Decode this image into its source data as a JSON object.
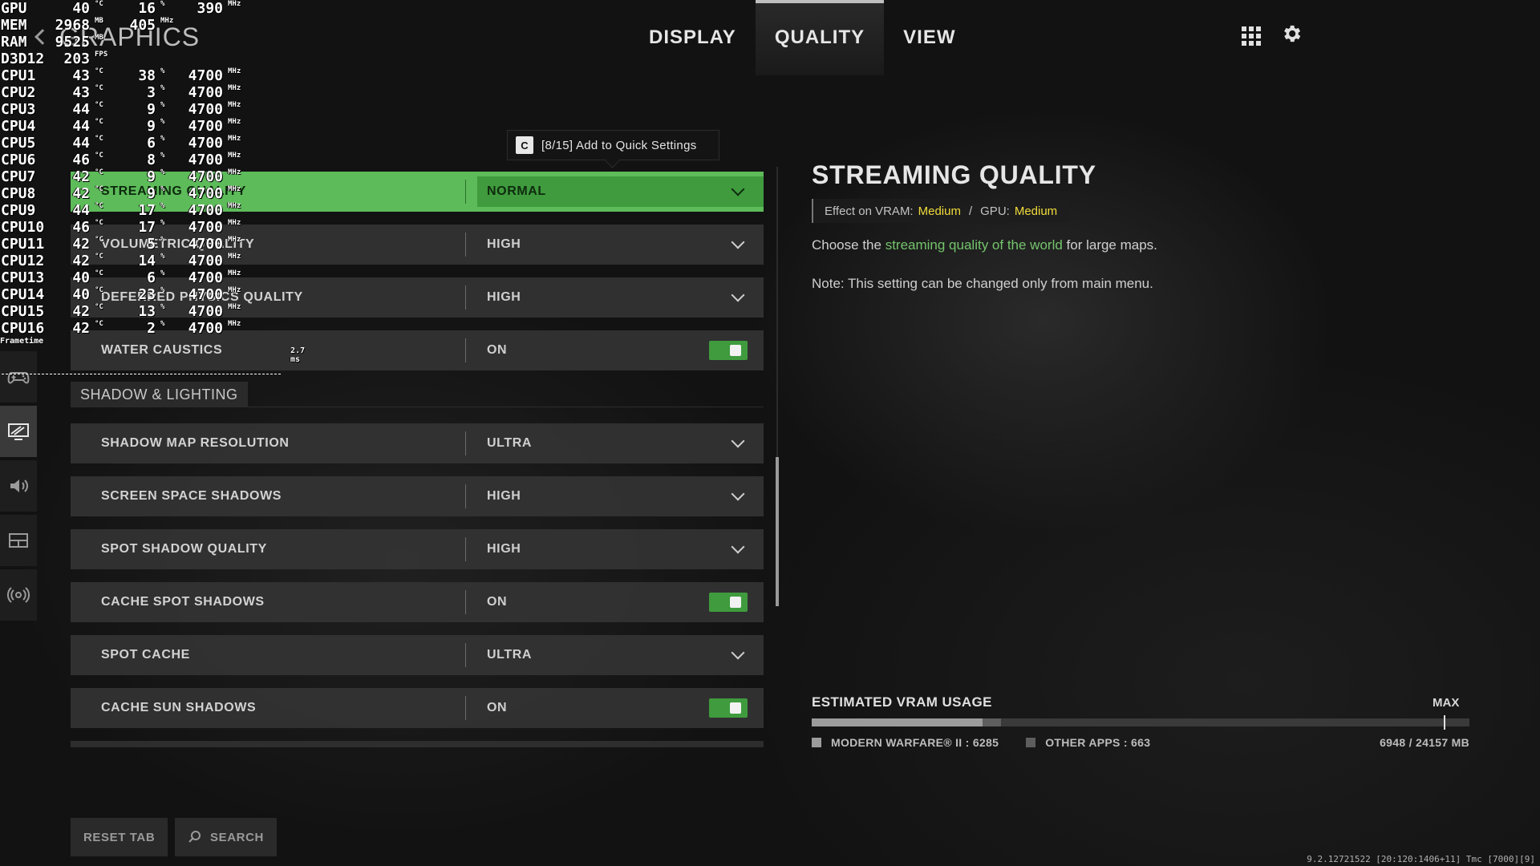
{
  "header": {
    "title": "GRAPHICS",
    "tabs": [
      {
        "label": "DISPLAY",
        "active": false
      },
      {
        "label": "QUALITY",
        "active": true
      },
      {
        "label": "VIEW",
        "active": false
      }
    ]
  },
  "left_nav": {
    "items": [
      {
        "icon": "controller-icon",
        "active": false
      },
      {
        "icon": "graphics-monitor-icon",
        "active": true
      },
      {
        "icon": "speaker-icon",
        "active": false
      },
      {
        "icon": "interface-icon",
        "active": false
      },
      {
        "icon": "network-icon",
        "active": false
      }
    ]
  },
  "tooltip": {
    "key": "C",
    "text": "[8/15] Add to Quick Settings"
  },
  "settings": {
    "rows_top": [
      {
        "label": "STREAMING QUALITY",
        "value": "NORMAL",
        "control": "dropdown",
        "selected": true
      },
      {
        "label": "VOLUMETRIC QUALITY",
        "value": "HIGH",
        "control": "dropdown"
      },
      {
        "label": "DEFERRED PHYSICS QUALITY",
        "value": "HIGH",
        "control": "dropdown"
      },
      {
        "label": "WATER CAUSTICS",
        "value": "ON",
        "control": "toggle"
      }
    ],
    "section_shadow": "SHADOW & LIGHTING",
    "rows_shadow": [
      {
        "label": "SHADOW MAP RESOLUTION",
        "value": "ULTRA",
        "control": "dropdown"
      },
      {
        "label": "SCREEN SPACE SHADOWS",
        "value": "HIGH",
        "control": "dropdown"
      },
      {
        "label": "SPOT SHADOW QUALITY",
        "value": "HIGH",
        "control": "dropdown"
      },
      {
        "label": "CACHE SPOT SHADOWS",
        "value": "ON",
        "control": "toggle"
      },
      {
        "label": "SPOT CACHE",
        "value": "ULTRA",
        "control": "dropdown"
      },
      {
        "label": "CACHE SUN SHADOWS",
        "value": "ON",
        "control": "toggle"
      }
    ]
  },
  "detail": {
    "title": "STREAMING QUALITY",
    "effect_vram_label": "Effect on VRAM:",
    "effect_vram_value": "Medium",
    "separator": "/",
    "effect_gpu_label": "GPU:",
    "effect_gpu_value": "Medium",
    "desc_prefix": "Choose the ",
    "desc_highlight": "streaming quality of the world",
    "desc_suffix": " for large maps.",
    "note": "Note: This setting can be changed only from main menu."
  },
  "vram": {
    "title": "ESTIMATED VRAM USAGE",
    "max_label": "MAX",
    "mw_label": "MODERN WARFARE® II : 6285",
    "other_label": "OTHER APPS : 663",
    "total_label": "6948 / 24157 MB",
    "mw_mb": 6285,
    "other_mb": 663,
    "max_fraction": 0.961,
    "bar_total_mb": 24157
  },
  "buttons": {
    "reset": "RESET TAB",
    "search": "SEARCH"
  },
  "build_info": "9.2.12721522 [20:120:1406+11] Tmc [7000][9]",
  "colors": {
    "accent_green": "#5dbb5a",
    "toggle_green": "#3f9b3d",
    "highlight_yellow": "#f2dc3a",
    "link_green": "#74c46c"
  },
  "hud": {
    "rows": [
      {
        "name": "GPU",
        "v1": "40",
        "u1": "°C",
        "v2": "16",
        "u2": "%",
        "v3": "390",
        "u3": "MHz"
      },
      {
        "name": "MEM",
        "v1": "2968",
        "u1": "MB",
        "v2": "405",
        "u2": "MHz",
        "v3": "",
        "u3": ""
      },
      {
        "name": "RAM",
        "v1": "9525",
        "u1": "MB",
        "v2": "",
        "u2": "",
        "v3": "",
        "u3": ""
      },
      {
        "name": "D3D12",
        "v1": "203",
        "u1": "FPS",
        "v2": "",
        "u2": "",
        "v3": "",
        "u3": ""
      },
      {
        "name": "CPU1",
        "v1": "43",
        "u1": "°C",
        "v2": "38",
        "u2": "%",
        "v3": "4700",
        "u3": "MHz"
      },
      {
        "name": "CPU2",
        "v1": "43",
        "u1": "°C",
        "v2": "3",
        "u2": "%",
        "v3": "4700",
        "u3": "MHz"
      },
      {
        "name": "CPU3",
        "v1": "44",
        "u1": "°C",
        "v2": "9",
        "u2": "%",
        "v3": "4700",
        "u3": "MHz"
      },
      {
        "name": "CPU4",
        "v1": "44",
        "u1": "°C",
        "v2": "9",
        "u2": "%",
        "v3": "4700",
        "u3": "MHz"
      },
      {
        "name": "CPU5",
        "v1": "44",
        "u1": "°C",
        "v2": "6",
        "u2": "%",
        "v3": "4700",
        "u3": "MHz"
      },
      {
        "name": "CPU6",
        "v1": "46",
        "u1": "°C",
        "v2": "8",
        "u2": "%",
        "v3": "4700",
        "u3": "MHz"
      },
      {
        "name": "CPU7",
        "v1": "42",
        "u1": "°C",
        "v2": "9",
        "u2": "%",
        "v3": "4700",
        "u3": "MHz"
      },
      {
        "name": "CPU8",
        "v1": "42",
        "u1": "°C",
        "v2": "9",
        "u2": "%",
        "v3": "4700",
        "u3": "MHz"
      },
      {
        "name": "CPU9",
        "v1": "44",
        "u1": "°C",
        "v2": "17",
        "u2": "%",
        "v3": "4700",
        "u3": "MHz"
      },
      {
        "name": "CPU10",
        "v1": "46",
        "u1": "°C",
        "v2": "17",
        "u2": "%",
        "v3": "4700",
        "u3": "MHz"
      },
      {
        "name": "CPU11",
        "v1": "42",
        "u1": "°C",
        "v2": "5",
        "u2": "%",
        "v3": "4700",
        "u3": "MHz"
      },
      {
        "name": "CPU12",
        "v1": "42",
        "u1": "°C",
        "v2": "14",
        "u2": "%",
        "v3": "4700",
        "u3": "MHz"
      },
      {
        "name": "CPU13",
        "v1": "40",
        "u1": "°C",
        "v2": "6",
        "u2": "%",
        "v3": "4700",
        "u3": "MHz"
      },
      {
        "name": "CPU14",
        "v1": "40",
        "u1": "°C",
        "v2": "23",
        "u2": "%",
        "v3": "4700",
        "u3": "MHz"
      },
      {
        "name": "CPU15",
        "v1": "42",
        "u1": "°C",
        "v2": "13",
        "u2": "%",
        "v3": "4700",
        "u3": "MHz"
      },
      {
        "name": "CPU16",
        "v1": "42",
        "u1": "°C",
        "v2": "2",
        "u2": "%",
        "v3": "4700",
        "u3": "MHz"
      }
    ],
    "frametime_label": "Frametime",
    "frametime_value": "2.7 ms"
  }
}
